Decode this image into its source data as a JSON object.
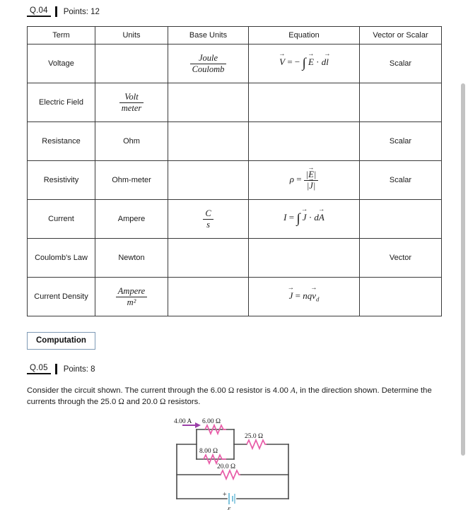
{
  "q4": {
    "number": "Q.04",
    "points": "Points: 12"
  },
  "table": {
    "headers": [
      "Term",
      "Units",
      "Base Units",
      "Equation",
      "Vector or Scalar"
    ],
    "rows": [
      {
        "term": "Voltage",
        "units": "",
        "base_units_num": "Joule",
        "base_units_den": "Coulomb",
        "equation": "V = − ∫ E · dl",
        "vector_or_scalar": "Scalar"
      },
      {
        "term": "Electric Field",
        "units_num": "Volt",
        "units_den": "meter",
        "base_units": "",
        "equation": "",
        "vector_or_scalar": ""
      },
      {
        "term": "Resistance",
        "units": "Ohm",
        "base_units": "",
        "equation": "",
        "vector_or_scalar": "Scalar"
      },
      {
        "term": "Resistivity",
        "units": "Ohm-meter",
        "base_units": "",
        "equation": "ρ = |E| / |J|",
        "vector_or_scalar": "Scalar"
      },
      {
        "term": "Current",
        "units": "Ampere",
        "base_units_num": "C",
        "base_units_den": "s",
        "equation": "I = ∫ J · dA",
        "vector_or_scalar": ""
      },
      {
        "term": "Coulomb's Law",
        "units": "Newton",
        "base_units": "",
        "equation": "",
        "vector_or_scalar": "Vector"
      },
      {
        "term": "Current Density",
        "units_num": "Ampere",
        "units_den": "m²",
        "base_units": "",
        "equation": "J = nq v_d",
        "vector_or_scalar": ""
      }
    ]
  },
  "section": {
    "computation_label": "Computation"
  },
  "q5": {
    "number": "Q.05",
    "points": "Points: 8",
    "text_part1": "Consider the circuit shown.  The current through the 6.00 ",
    "ohm1": "Ω",
    "text_part2": " resistor is 4.00 ",
    "amp": "A",
    "text_part3": ", in the direction shown. Determine the currents through the 25.0 ",
    "ohm2": "Ω",
    "text_part4": " and 20.0 ",
    "ohm3": "Ω",
    "text_part5": " resistors."
  },
  "circuit": {
    "current_label": "4.00 A",
    "r1_label": "6.00 Ω",
    "r2_label": "8.00 Ω",
    "r3_label": "25.0 Ω",
    "r4_label": "20.0 Ω",
    "battery_plus": "+",
    "emf_label": "ε",
    "wire_color": "#4a4a4a",
    "resistor_color": "#e85ca8",
    "arrow_color": "#9b3fa8",
    "battery_color": "#7fc4dd"
  }
}
